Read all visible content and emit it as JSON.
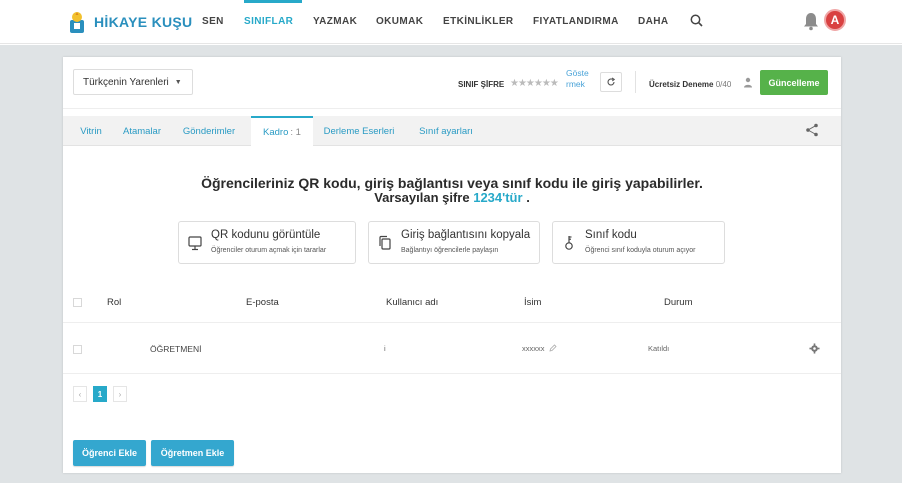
{
  "nav": {
    "brand": "HİKAYE KUŞU",
    "items": [
      {
        "label": "SEN"
      },
      {
        "label": "SINIFLAR"
      },
      {
        "label": "YAZMAK"
      },
      {
        "label": "OKUMAK"
      },
      {
        "label": "ETKİNLİKLER"
      },
      {
        "label": "FIYATLANDIRMA"
      },
      {
        "label": "DAHA"
      }
    ],
    "active_item": "SINIFLAR",
    "avatar_letter": "A",
    "icons": [
      "search-icon",
      "bell-icon"
    ]
  },
  "class_bar": {
    "selected_class": "Türkçenin Yarenleri",
    "password_label": "SINIF ŞİFRE",
    "password_mask": "★★★★★★",
    "show_link": "Göste rmek",
    "trial_label": "Ücretsiz Deneme",
    "trial_count": "0/40",
    "upgrade_button": "Güncelleme"
  },
  "tabs": [
    {
      "label": "Vitrin"
    },
    {
      "label": "Atamalar"
    },
    {
      "label": "Gönderimler"
    },
    {
      "label": "Kadro",
      "count": ": 1"
    },
    {
      "label": "Derleme Eserleri"
    },
    {
      "label": "Sınıf ayarları"
    }
  ],
  "active_tab": "Kadro",
  "info": {
    "heading": "Öğrencileriniz QR kodu, giriş bağlantısı veya sınıf kodu ile giriş yapabilirler.",
    "default_password_prefix": "Varsayılan şifre",
    "default_password": "1234'tür",
    "default_password_suffix": "."
  },
  "actions": [
    {
      "title": "QR kodunu görüntüle",
      "desc": "Öğrenciler oturum açmak için tararlar",
      "icon": "monitor-icon"
    },
    {
      "title": "Giriş bağlantısını kopyala",
      "desc": "Bağlantıyı öğrencilerle paylaşın",
      "icon": "copy-icon"
    },
    {
      "title": "Sınıf kodu",
      "desc": "Öğrenci sınıf koduyla oturum açıyor",
      "icon": "key-icon"
    }
  ],
  "table": {
    "headers": [
      "Rol",
      "E-posta",
      "Kullanıcı adı",
      "İsim",
      "Durum"
    ],
    "rows": [
      {
        "role": "ÖĞRETMENİ",
        "email": "",
        "username": "i",
        "name": "xxxxxx",
        "status": "Katıldı"
      }
    ]
  },
  "pagination": {
    "prev": "‹",
    "current": "1",
    "next": "›"
  },
  "buttons": {
    "add_student": "Öğrenci Ekle",
    "add_teacher": "Öğretmen Ekle"
  },
  "colors": {
    "accent": "#27a9c9",
    "upgrade": "#56b24a",
    "avatar": "#d94141"
  }
}
